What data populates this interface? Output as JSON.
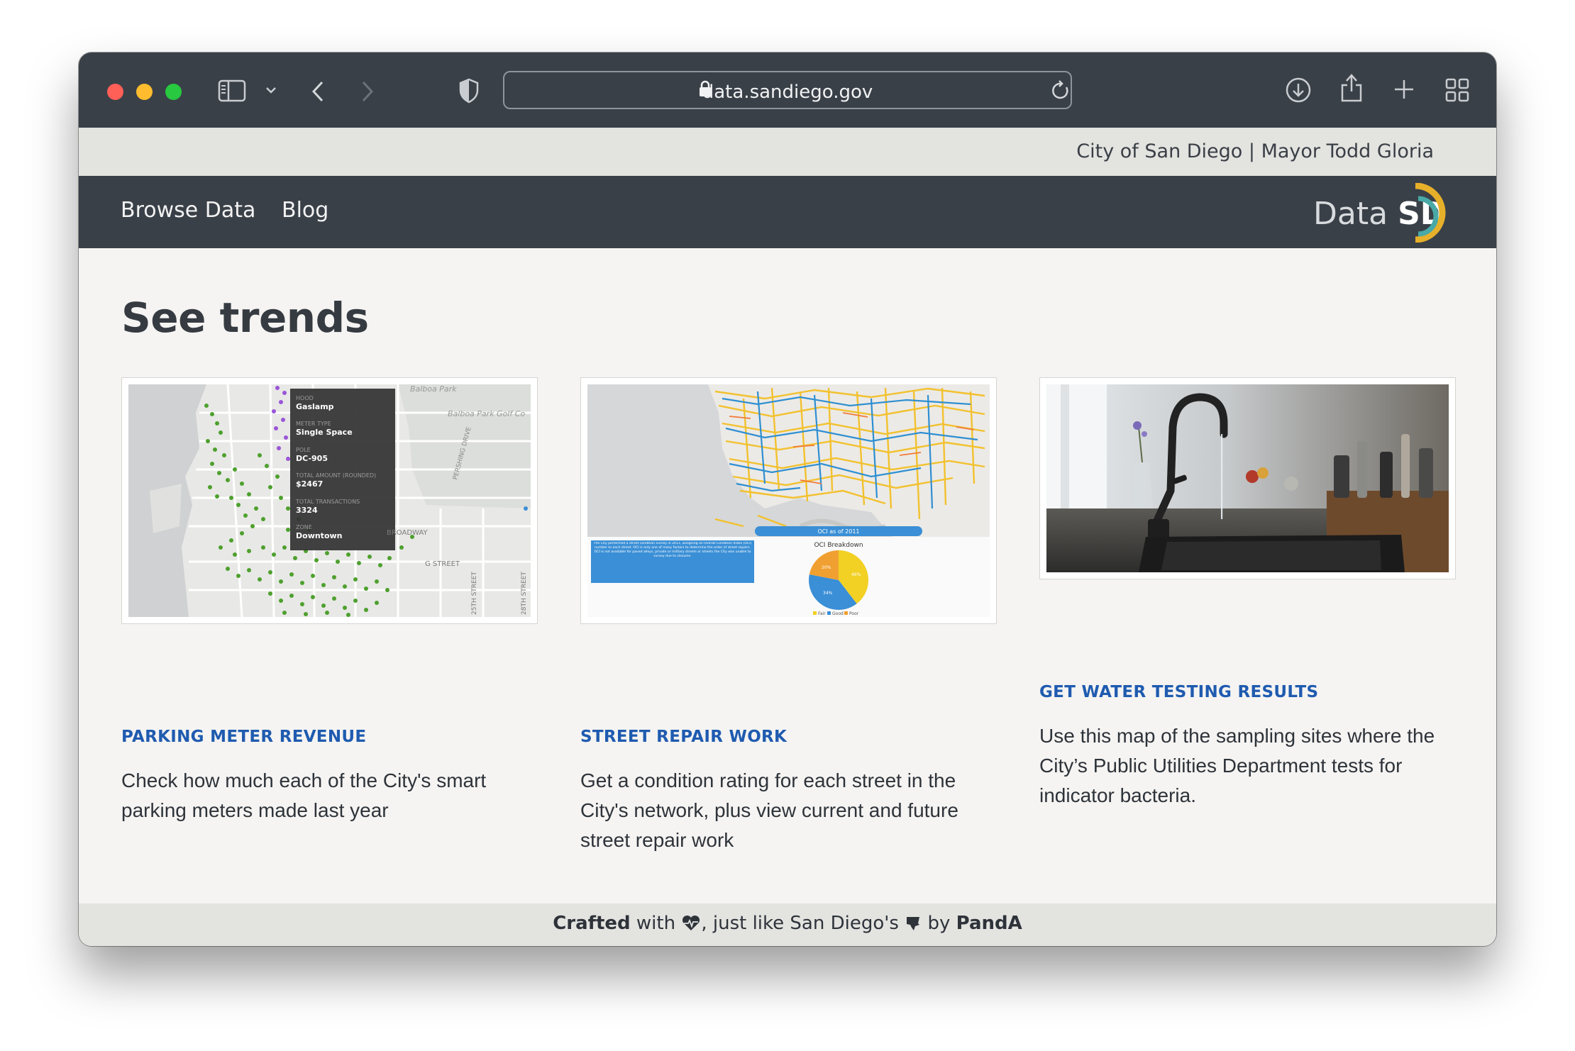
{
  "browser": {
    "url": "data.sandiego.gov",
    "buttons": [
      "sidebar",
      "back",
      "forward",
      "shield",
      "reload",
      "download",
      "share",
      "new-tab",
      "tab-overview"
    ]
  },
  "citybar": {
    "text": "City of San Diego | Mayor Todd Gloria"
  },
  "nav": {
    "links": [
      "Browse Data",
      "Blog"
    ],
    "logo": {
      "word": "Data",
      "abbr": "SD"
    }
  },
  "main": {
    "heading": "See trends",
    "cards": [
      {
        "title": "PARKING METER REVENUE",
        "description": "Check how much each of the City's smart parking meters made last year",
        "thumbnail": {
          "map_labels": [
            "Balboa Park",
            "Balboa Park Golf Co",
            "PERSHING DRIVE",
            "G STREET",
            "BROADWAY",
            "25TH STREET",
            "28TH STREET"
          ],
          "tooltip": [
            {
              "label": "HOOD",
              "value": "Gaslamp"
            },
            {
              "label": "METER TYPE",
              "value": "Single Space"
            },
            {
              "label": "POLE",
              "value": "DC-905"
            },
            {
              "label": "TOTAL AMOUNT (ROUNDED)",
              "value": "$2467"
            },
            {
              "label": "TOTAL TRANSACTIONS",
              "value": "3324"
            },
            {
              "label": "ZONE",
              "value": "Downtown"
            }
          ]
        }
      },
      {
        "title": "STREET REPAIR WORK",
        "description": "Get a condition rating for each street in the City's network, plus view current and future street repair work",
        "thumbnail": {
          "dropdown": "OCI as of 2011",
          "chart_title": "OCI Breakdown",
          "info": "The City performed a street condition survey in 2011, assigning an Overall Condition Index (OCI) number to each street. OCI is only one of many factors to determine the order of street repairs. OCI is not available for paved alleys, private or military streets or streets the City was unable to survey due to closures.",
          "legend": [
            "Fair",
            "Good",
            "Poor"
          ],
          "pie_labels": [
            "20%",
            "34%",
            "46%"
          ],
          "colors": {
            "fair": "#f2d024",
            "good": "#3a8fd6",
            "poor": "#f0a030"
          }
        }
      },
      {
        "title": "GET WATER TESTING RESULTS",
        "description": "Use this map of the sampling sites where the City’s Public Utilities Department tests for indicator bacteria."
      }
    ]
  },
  "footer": {
    "crafted": "Crafted",
    "with": "with",
    "middle": ", just like San Diego's",
    "by": "by",
    "author": "PandA",
    "icons": [
      "heart-icon",
      "flag-icon"
    ]
  },
  "colors": {
    "chrome": "#3a4048",
    "accent_link": "#1f5bb0",
    "page_bg": "#f5f4f2",
    "citybar_bg": "#e3e3e0"
  }
}
